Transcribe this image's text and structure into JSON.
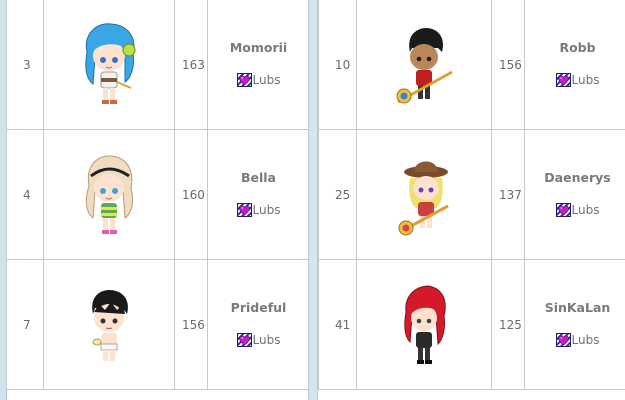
{
  "tables": [
    {
      "rows": [
        {
          "rank": "3",
          "level": "163",
          "name": "Momorii",
          "guild": "Lubs",
          "avatar": "blue-haired-girl-avatar"
        },
        {
          "rank": "4",
          "level": "160",
          "name": "Bella",
          "guild": "Lubs",
          "avatar": "blonde-girl-avatar"
        },
        {
          "rank": "7",
          "level": "156",
          "name": "Prideful",
          "guild": "Lubs",
          "avatar": "dark-haired-boy-avatar"
        }
      ]
    },
    {
      "rows": [
        {
          "rank": "10",
          "level": "156",
          "name": "Robb",
          "guild": "Lubs",
          "avatar": "staff-wielder-avatar"
        },
        {
          "rank": "25",
          "level": "137",
          "name": "Daenerys",
          "guild": "Lubs",
          "avatar": "cowboy-hat-girl-avatar"
        },
        {
          "rank": "41",
          "level": "125",
          "name": "SinKaLan",
          "guild": "Lubs",
          "avatar": "red-haired-avatar"
        }
      ]
    }
  ],
  "colors": {
    "border": "#c8c8c8",
    "divider": "#d4e5f0",
    "text": "#6a6a6a"
  }
}
